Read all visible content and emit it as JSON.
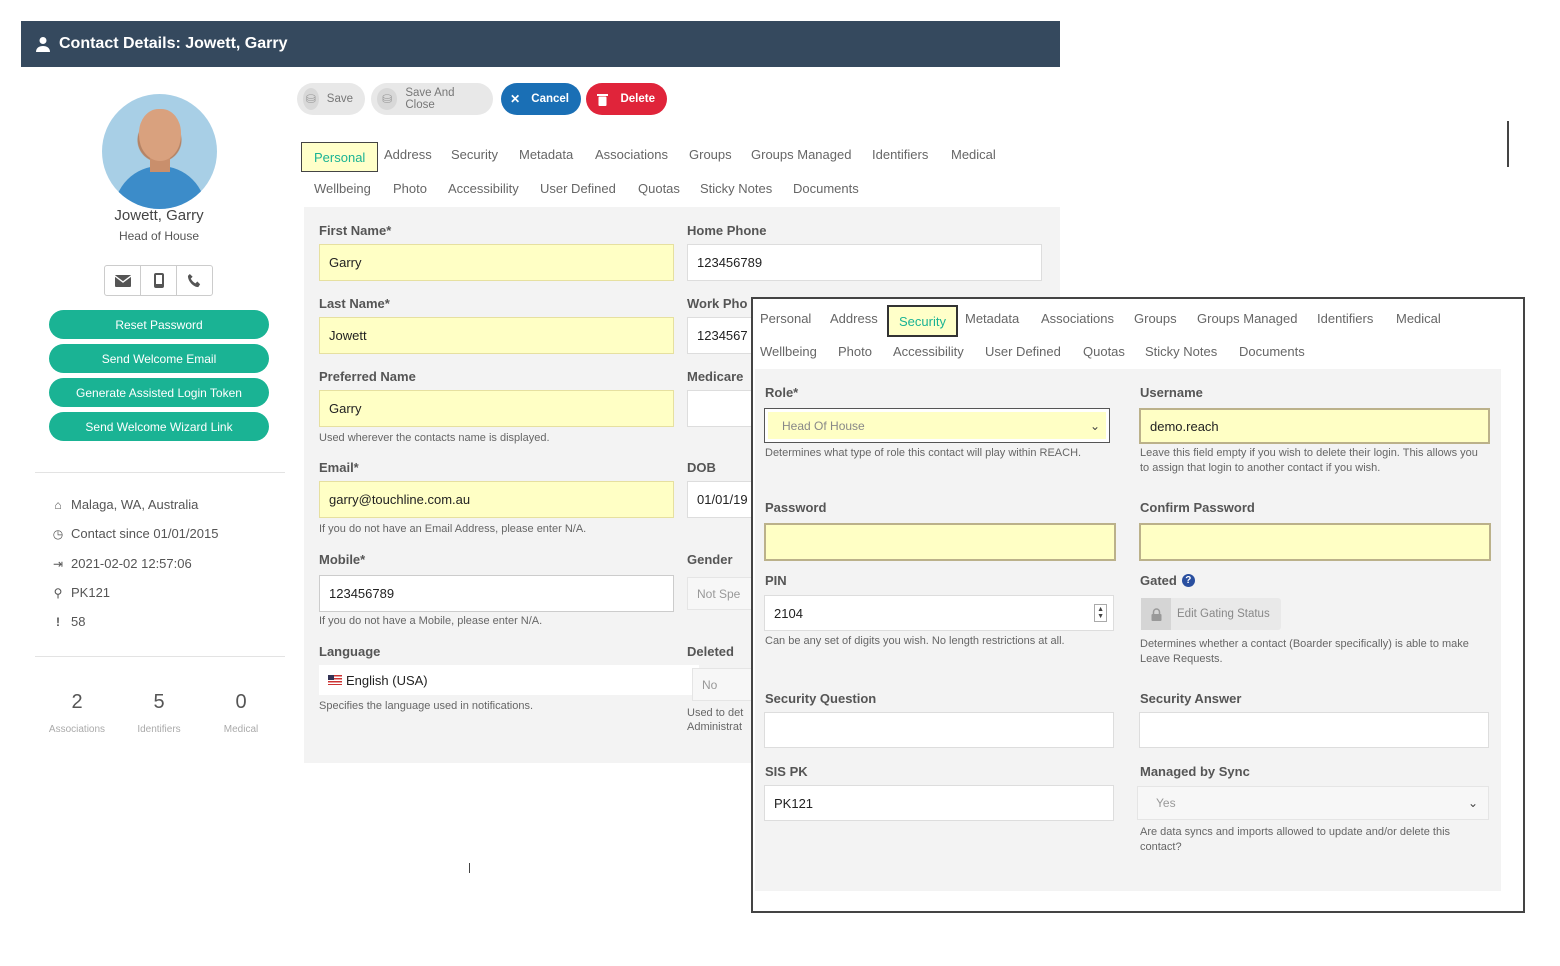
{
  "window": {
    "title": "Contact Details: Jowett, Garry"
  },
  "sidebar": {
    "name": "Jowett, Garry",
    "role": "Head of House",
    "actions": [
      "Reset Password",
      "Send Welcome Email",
      "Generate Assisted Login Token",
      "Send Welcome Wizard Link"
    ],
    "location": "Malaga, WA, Australia",
    "contact_since": "Contact since 01/01/2015",
    "last_login": "2021-02-02 12:57:06",
    "pk": "PK121",
    "alerts": "58",
    "stats": [
      {
        "value": "2",
        "label": "Associations"
      },
      {
        "value": "5",
        "label": "Identifiers"
      },
      {
        "value": "0",
        "label": "Medical"
      }
    ]
  },
  "toolbar": {
    "save": "Save",
    "save_close": "Save And Close",
    "cancel": "Cancel",
    "delete": "Delete"
  },
  "tabs_row1": [
    "Personal",
    "Address",
    "Security",
    "Metadata",
    "Associations",
    "Groups",
    "Groups Managed",
    "Identifiers",
    "Medical"
  ],
  "tabs_row2": [
    "Wellbeing",
    "Photo",
    "Accessibility",
    "User Defined",
    "Quotas",
    "Sticky Notes",
    "Documents"
  ],
  "personal": {
    "first_name_label": "First Name*",
    "first_name": "Garry",
    "last_name_label": "Last Name*",
    "last_name": "Jowett",
    "preferred_label": "Preferred Name",
    "preferred": "Garry",
    "preferred_help": "Used wherever the contacts name is displayed.",
    "email_label": "Email*",
    "email": "garry@touchline.com.au",
    "email_help": "If you do not have an Email Address, please enter N/A.",
    "mobile_label": "Mobile*",
    "mobile": "123456789",
    "mobile_help": "If you do not have a Mobile, please enter N/A.",
    "language_label": "Language",
    "language": "English (USA)",
    "language_help": "Specifies the language used in notifications.",
    "home_phone_label": "Home Phone",
    "home_phone": "123456789",
    "work_phone_label": "Work Pho",
    "work_phone": "1234567",
    "medicare_label": "Medicare",
    "dob_label": "DOB",
    "dob": "01/01/19",
    "gender_label": "Gender",
    "gender": "Not Spe",
    "deleted_label": "Deleted",
    "deleted": "No",
    "deleted_help_1": "Used to det",
    "deleted_help_2": "Administrat"
  },
  "security": {
    "role_label": "Role*",
    "role": "Head Of House",
    "role_help": "Determines what type of role this contact will play within REACH.",
    "username_label": "Username",
    "username": "demo.reach",
    "username_help": "Leave this field empty if you wish to delete their login. This allows you to assign that login to another contact if you wish.",
    "password_label": "Password",
    "confirm_label": "Confirm Password",
    "pin_label": "PIN",
    "pin": "2104",
    "pin_help": "Can be any set of digits you wish. No length restrictions at all.",
    "gated_label": "Gated",
    "gating_button": "Edit Gating Status",
    "gated_help": "Determines whether a contact (Boarder specifically) is able to make Leave Requests.",
    "question_label": "Security Question",
    "answer_label": "Security Answer",
    "sispk_label": "SIS PK",
    "sispk": "PK121",
    "sync_label": "Managed by Sync",
    "sync": "Yes",
    "sync_help": "Are data syncs and imports allowed to update and/or delete this contact?"
  },
  "colors": {
    "header": "#35495e",
    "accent": "#1ab394",
    "cancel": "#1a6fb5",
    "delete": "#e0243a",
    "required_bg": "#ffffc5"
  }
}
